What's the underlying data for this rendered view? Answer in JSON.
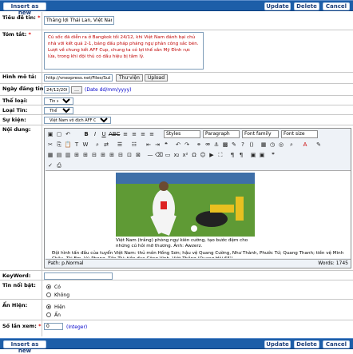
{
  "toolbar": {
    "insert_label": "Insert as new",
    "update_label": "Update",
    "delete_label": "Delete",
    "cancel_label": "Cancel"
  },
  "fields": {
    "title": {
      "label": "Tiêu đề tin:",
      "required": "*",
      "value": "Thắng lợi Thái Lan, Việt Nam dừng b"
    },
    "summary": {
      "label": "Tóm tắt:",
      "required": "*",
      "value": "Cú sốc đã diễn ra ở Bangkok tối 24/12, khi Việt Nam đánh bại chủ nhà với kết quả 2-1, bảng đấu pháp pháng ngự phản công sắc bén. Lượt về chung kết AFF Cup, chung ta có lợi thế sân Mỹ Đình rực lửa, trong khi đội thủ có dấu hiệu bị tâm lý."
    },
    "image": {
      "label": "Hình mô tả:",
      "value": "http://vnexpress.net/Files/Subject/",
      "library_button": "Thư viện",
      "upload_button": "Upload"
    },
    "date": {
      "label": "Ngày đăng tin:",
      "value": "24/12/2008",
      "hint": "(Date dd/mm/yyyy)"
    },
    "category": {
      "label": "Thể loại:",
      "value": "Tin xã hội"
    },
    "type": {
      "label": "Loại Tin:",
      "value": "Thể thao"
    },
    "event": {
      "label": "Sự kiện:",
      "value": "Việt Nam vô địch AFF Cup"
    },
    "content": {
      "label": "Nội dung:"
    },
    "keyword": {
      "label": "KeyWord:",
      "value": ""
    },
    "featured": {
      "label": "Tin nổi bật:",
      "options": [
        "Có",
        "Không"
      ],
      "selected": 0
    },
    "hidden": {
      "label": "Ẩn Hiện:",
      "options": [
        "Hiện",
        "Ẩn"
      ],
      "selected": 0
    },
    "views": {
      "label": "Số lần xem:",
      "required": "*",
      "value": "0",
      "hint": "(Integer)"
    }
  },
  "editor": {
    "style_select": "Styles",
    "paragraph_select": "Paragraph",
    "font_family_select": "Font family",
    "font_size_select": "Font size",
    "caption": "Việt Nam (trắng) phòng ngự kiên cường, tạo bước đệm cho những cú hỏi mỡ thương. Ảnh: Awzerz.",
    "paragraph": "Đội hình tấn đầu của tuyển Việt Nam: thủ môn Hồng Sơn; hậu vệ Quang Cường, Như Thành, Phước Tứ; Quang Thanh; tiền vệ Minh Châu, Tài Em, Vũ Phong, Tấn Tài; tiền đạo Công Vinh, Việt Thắng (Quang Hải 65').",
    "path": "Path: p.Normal",
    "word_count": "Words: 1745"
  }
}
